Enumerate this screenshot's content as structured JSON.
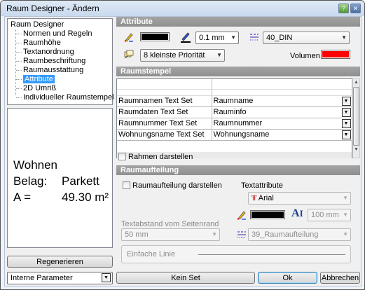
{
  "window": {
    "title": "Raum Designer - Ändern"
  },
  "tree": {
    "root": "Raum Designer",
    "items": [
      "Normen und Regeln",
      "Raumhöhe",
      "Textanordnung",
      "Raumbeschriftung",
      "Raumausstattung",
      "Attribute",
      "2D Umriß",
      "Individueller Raumstempel"
    ],
    "selected_index": 5
  },
  "preview": {
    "line1": "Wohnen",
    "line2_label": "Belag:",
    "line2_value": "Parkett",
    "line3_label": "A =",
    "line3_value": "49.30 m²"
  },
  "left_bottom": {
    "regenerate": "Regenerieren",
    "params_combo": "Interne Parameter"
  },
  "attribute": {
    "header": "Attribute",
    "pen_color": "#000000",
    "linewidth": "0.1 mm",
    "linetype": "40_DIN",
    "priority": "8 kleinste Priorität",
    "volume_label": "Volumen",
    "volume_color": "#ff0000"
  },
  "raumstempel": {
    "header": "Raumstempel",
    "rows": [
      {
        "label": "Raumnamen Text Set",
        "value": "Raumname"
      },
      {
        "label": "Raumdaten Text Set",
        "value": "Rauminfo"
      },
      {
        "label": "Raumnummer Text Set",
        "value": "Raumnummer"
      },
      {
        "label": "Wohnungsname Text Set",
        "value": "Wohnungsname"
      }
    ],
    "frame_checkbox": "Rahmen darstellen"
  },
  "raumaufteilung": {
    "header": "Raumaufteilung",
    "checkbox": "Raumaufteilung darstellen",
    "textattr_label": "Textattribute",
    "font": "Arial",
    "text_color": "#000000",
    "text_height": "100 mm",
    "distance_label": "Textabstand vom Seitenrand",
    "distance_value": "50 mm",
    "linetype": "39_Raumaufteilung",
    "line_style": "Einfache Linie"
  },
  "footer": {
    "kein_set": "Kein Set",
    "ok": "Ok",
    "cancel": "Abbrechen"
  },
  "colors": {
    "section_header": "#999999",
    "selection": "#3399ff"
  }
}
